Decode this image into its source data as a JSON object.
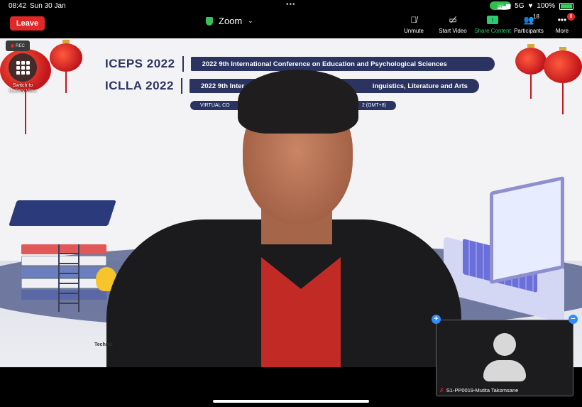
{
  "status_bar": {
    "time": "08:42",
    "date": "Sun 30 Jan",
    "signal": "5G",
    "battery": "100%"
  },
  "toolbar": {
    "leave_label": "Leave",
    "meeting_title": "Zoom",
    "unmute_label": "Unmute",
    "start_video_label": "Start Video",
    "share_content_label": "Share Content",
    "participants_label": "Participants",
    "participants_count": "18",
    "more_label": "More",
    "more_badge": "8",
    "accent_color": "#2ecc71",
    "leave_color": "#e02828"
  },
  "stage": {
    "rec_label": "REC",
    "gallery_label": "Switch to Gallery View",
    "banner": {
      "row1_acronym": "ICEPS 2022",
      "row1_title": "2022 9th International Conference on Education and Psychological Sciences",
      "row2_acronym": "ICLLA 2022",
      "row2_title_left": "2022 9th Inter",
      "row2_title_right": "inguistics, Literature and Arts",
      "virtual_left": "VIRTUAL CO",
      "virtual_right": "2 (GMT+8)"
    },
    "footer_text": "Technic"
  },
  "thumbnail": {
    "participant_name": "S1-PP0019-Mutita Takomsane",
    "add_label": "+",
    "minimize_label": "−"
  }
}
